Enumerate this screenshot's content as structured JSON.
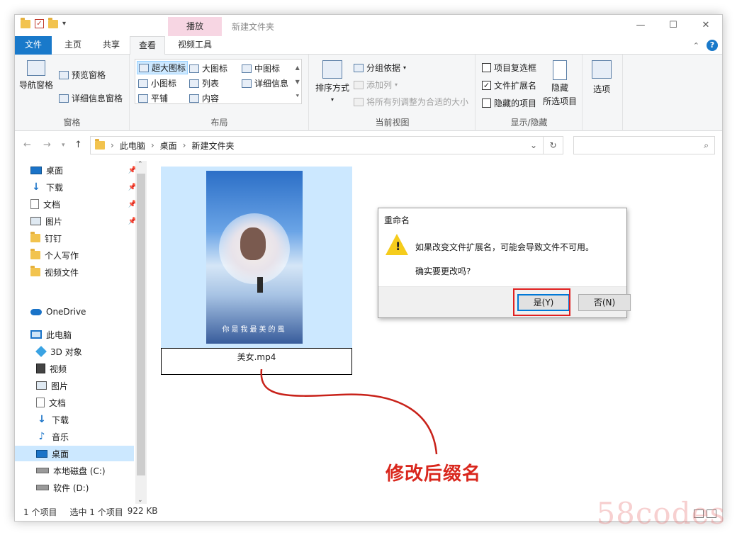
{
  "window": {
    "title": "新建文件夹",
    "context_tab": "播放",
    "controls": {
      "minimize": "—",
      "maximize": "☐",
      "close": "✕"
    }
  },
  "ribbon_tabs": {
    "file": "文件",
    "home": "主页",
    "share": "共享",
    "view": "查看",
    "video_tools": "视频工具"
  },
  "ribbon": {
    "panes": {
      "label": "窗格",
      "nav_pane": "导航窗格",
      "preview_pane": "预览窗格",
      "details_pane": "详细信息窗格"
    },
    "layout": {
      "label": "布局",
      "items": [
        "超大图标",
        "大图标",
        "中图标",
        "小图标",
        "列表",
        "详细信息",
        "平铺",
        "内容"
      ],
      "selected": "超大图标"
    },
    "current_view": {
      "label": "当前视图",
      "sort_by": "排序方式",
      "group_by": "分组依据",
      "add_column": "添加列",
      "fit_columns": "将所有列调整为合适的大小"
    },
    "show_hide": {
      "label": "显示/隐藏",
      "item_checkboxes": "项目复选框",
      "item_checkboxes_checked": false,
      "file_extensions": "文件扩展名",
      "file_extensions_checked": true,
      "hidden_items": "隐藏的项目",
      "hidden_items_checked": false,
      "hide_selected_line1": "隐藏",
      "hide_selected_line2": "所选项目"
    },
    "options": "选项"
  },
  "address": {
    "crumbs": [
      "此电脑",
      "桌面",
      "新建文件夹"
    ],
    "search_placeholder": ""
  },
  "nav_pane": {
    "quick_access": [
      {
        "label": "桌面",
        "icon": "desktop-icon",
        "pinned": true
      },
      {
        "label": "下载",
        "icon": "download-icon",
        "pinned": true
      },
      {
        "label": "文档",
        "icon": "document-icon",
        "pinned": true
      },
      {
        "label": "图片",
        "icon": "picture-icon",
        "pinned": true
      },
      {
        "label": "钉钉",
        "icon": "folder-icon",
        "pinned": false
      },
      {
        "label": "个人写作",
        "icon": "folder-icon",
        "pinned": false
      },
      {
        "label": "视频文件",
        "icon": "folder-icon",
        "pinned": false
      }
    ],
    "onedrive": "OneDrive",
    "this_pc": "此电脑",
    "pc_items": [
      {
        "label": "3D 对象",
        "icon": "3d-objects-icon"
      },
      {
        "label": "视频",
        "icon": "video-icon"
      },
      {
        "label": "图片",
        "icon": "picture-icon"
      },
      {
        "label": "文档",
        "icon": "document-icon"
      },
      {
        "label": "下载",
        "icon": "download-icon"
      },
      {
        "label": "音乐",
        "icon": "music-icon"
      },
      {
        "label": "桌面",
        "icon": "desktop-icon",
        "selected": true
      },
      {
        "label": "本地磁盘 (C:)",
        "icon": "drive-icon"
      },
      {
        "label": "软件 (D:)",
        "icon": "drive-icon"
      }
    ]
  },
  "file": {
    "name": "美女.mp4",
    "thumbnail_caption": "你是我最美的風"
  },
  "dialog": {
    "title": "重命名",
    "message": "如果改变文件扩展名，可能会导致文件不可用。",
    "question": "确实要更改吗?",
    "yes": "是(Y)",
    "no": "否(N)"
  },
  "annotation": "修改后缀名",
  "status": {
    "count": "1 个项目",
    "selected": "选中 1 个项目",
    "size": "922 KB"
  },
  "watermark": "58codes",
  "colors": {
    "accent": "#1979ca",
    "selection": "#cce8ff",
    "annotation_red": "#d9271d",
    "warning_yellow": "#f5cc1c"
  }
}
